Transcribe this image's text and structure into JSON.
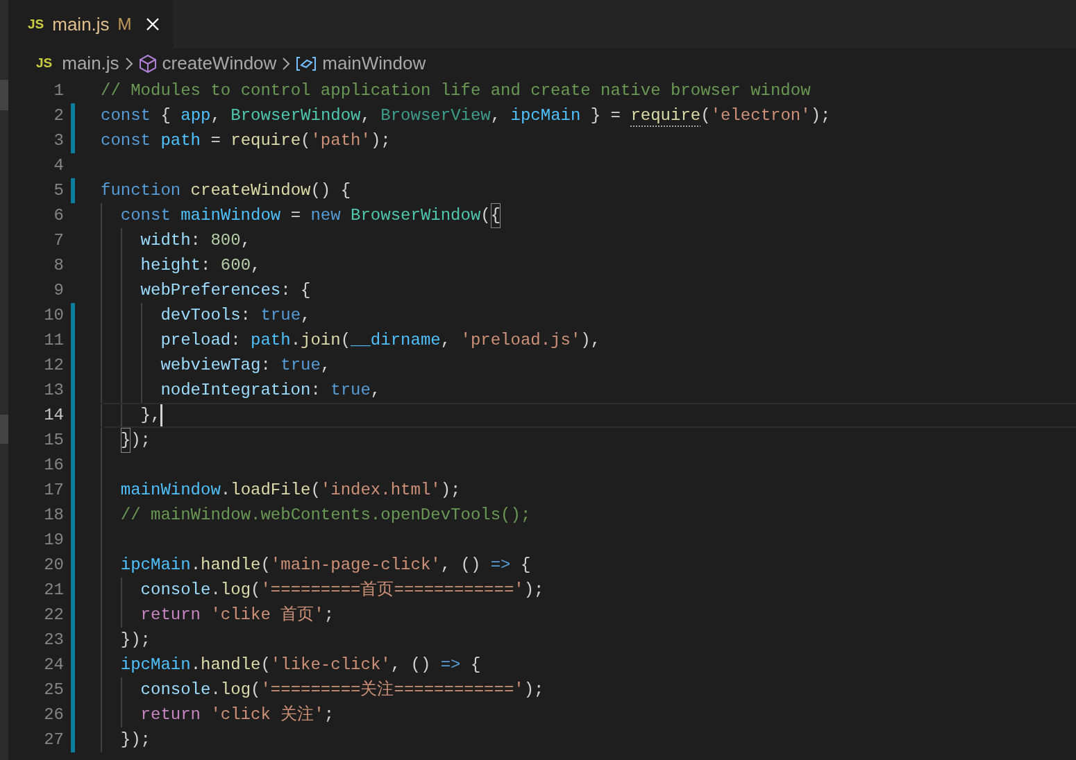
{
  "tab": {
    "file_badge": "JS",
    "title": "main.js",
    "status": "M",
    "selected": true
  },
  "breadcrumbs": [
    {
      "kind": "file",
      "badge": "JS",
      "label": "main.js"
    },
    {
      "kind": "function",
      "label": "createWindow"
    },
    {
      "kind": "variable",
      "label": "mainWindow"
    }
  ],
  "lines": [
    {
      "number": "1",
      "changed": false,
      "current": false,
      "tokens": [
        {
          "kind": "comment",
          "text": "// Modules to control application life and create native browser window"
        }
      ]
    },
    {
      "number": "2",
      "changed": true,
      "current": false,
      "tokens": [
        {
          "kind": "keyword",
          "text": "const"
        },
        {
          "kind": "punct",
          "text": " { "
        },
        {
          "kind": "variable",
          "text": "app"
        },
        {
          "kind": "punct",
          "text": ", "
        },
        {
          "kind": "class",
          "text": "BrowserWindow"
        },
        {
          "kind": "punct",
          "text": ", "
        },
        {
          "kind": "class-unused",
          "text": "BrowserView"
        },
        {
          "kind": "punct",
          "text": ", "
        },
        {
          "kind": "variable",
          "text": "ipcMain"
        },
        {
          "kind": "punct",
          "text": " } = "
        },
        {
          "kind": "function-hint",
          "text": "require"
        },
        {
          "kind": "punct",
          "text": "("
        },
        {
          "kind": "string",
          "text": "'electron'"
        },
        {
          "kind": "punct",
          "text": ");"
        }
      ]
    },
    {
      "number": "3",
      "changed": true,
      "current": false,
      "tokens": [
        {
          "kind": "keyword",
          "text": "const"
        },
        {
          "kind": "variable",
          "text": "path",
          "space_before": true
        },
        {
          "kind": "punct",
          "text": " = "
        },
        {
          "kind": "function",
          "text": "require"
        },
        {
          "kind": "punct",
          "text": "("
        },
        {
          "kind": "string",
          "text": "'path'"
        },
        {
          "kind": "punct",
          "text": ");"
        }
      ]
    },
    {
      "number": "4",
      "changed": false,
      "current": false
    },
    {
      "number": "5",
      "changed": true,
      "current": false,
      "tokens": [
        {
          "kind": "keyword",
          "text": "function"
        },
        {
          "kind": "function",
          "text": "createWindow",
          "space_before": true
        },
        {
          "kind": "punct",
          "text": "() {"
        }
      ],
      "children": [
        {
          "number": "6",
          "changed": false,
          "current": false,
          "tokens": [
            {
              "kind": "keyword",
              "text": "const"
            },
            {
              "kind": "variable",
              "text": "mainWindow",
              "space_before": true
            },
            {
              "kind": "punct",
              "text": " = "
            },
            {
              "kind": "keyword",
              "text": "new"
            },
            {
              "kind": "class",
              "text": "BrowserWindow",
              "space_before": true
            },
            {
              "kind": "punct",
              "text": "("
            },
            {
              "kind": "bracket-match",
              "text": "{"
            }
          ],
          "children": [
            {
              "number": "7",
              "changed": false,
              "current": false,
              "tokens": [
                {
                  "kind": "property",
                  "text": "width"
                },
                {
                  "kind": "punct",
                  "text": ": "
                },
                {
                  "kind": "number",
                  "text": "800"
                },
                {
                  "kind": "punct",
                  "text": ","
                }
              ]
            },
            {
              "number": "8",
              "changed": false,
              "current": false,
              "tokens": [
                {
                  "kind": "property",
                  "text": "height"
                },
                {
                  "kind": "punct",
                  "text": ": "
                },
                {
                  "kind": "number",
                  "text": "600"
                },
                {
                  "kind": "punct",
                  "text": ","
                }
              ]
            },
            {
              "number": "9",
              "changed": false,
              "current": false,
              "tokens": [
                {
                  "kind": "property",
                  "text": "webPreferences"
                },
                {
                  "kind": "punct",
                  "text": ": {"
                }
              ],
              "children": [
                {
                  "number": "10",
                  "changed": true,
                  "current": false,
                  "tokens": [
                    {
                      "kind": "property",
                      "text": "devTools"
                    },
                    {
                      "kind": "punct",
                      "text": ": "
                    },
                    {
                      "kind": "keyword",
                      "text": "true"
                    },
                    {
                      "kind": "punct",
                      "text": ","
                    }
                  ]
                },
                {
                  "number": "11",
                  "changed": true,
                  "current": false,
                  "tokens": [
                    {
                      "kind": "property",
                      "text": "preload"
                    },
                    {
                      "kind": "punct",
                      "text": ": "
                    },
                    {
                      "kind": "variable",
                      "text": "path"
                    },
                    {
                      "kind": "punct",
                      "text": "."
                    },
                    {
                      "kind": "function",
                      "text": "join"
                    },
                    {
                      "kind": "punct",
                      "text": "("
                    },
                    {
                      "kind": "variable",
                      "text": "__dirname"
                    },
                    {
                      "kind": "punct",
                      "text": ", "
                    },
                    {
                      "kind": "string",
                      "text": "'preload.js'"
                    },
                    {
                      "kind": "punct",
                      "text": "),"
                    }
                  ]
                },
                {
                  "number": "12",
                  "changed": true,
                  "current": false,
                  "tokens": [
                    {
                      "kind": "property",
                      "text": "webviewTag"
                    },
                    {
                      "kind": "punct",
                      "text": ": "
                    },
                    {
                      "kind": "keyword",
                      "text": "true"
                    },
                    {
                      "kind": "punct",
                      "text": ","
                    }
                  ]
                },
                {
                  "number": "13",
                  "changed": true,
                  "current": false,
                  "tokens": [
                    {
                      "kind": "property",
                      "text": "nodeIntegration"
                    },
                    {
                      "kind": "punct",
                      "text": ": "
                    },
                    {
                      "kind": "keyword",
                      "text": "true"
                    },
                    {
                      "kind": "punct",
                      "text": ","
                    }
                  ]
                }
              ]
            },
            {
              "number": "14",
              "changed": true,
              "current": true,
              "tokens": [
                {
                  "kind": "punct",
                  "text": "},"
                }
              ]
            }
          ]
        },
        {
          "number": "15",
          "changed": true,
          "current": false,
          "tokens": [
            {
              "kind": "bracket-match",
              "text": "}"
            },
            {
              "kind": "punct",
              "text": ");"
            }
          ]
        },
        {
          "number": "16",
          "changed": true,
          "current": false
        },
        {
          "number": "17",
          "changed": true,
          "current": false,
          "tokens": [
            {
              "kind": "variable",
              "text": "mainWindow"
            },
            {
              "kind": "punct",
              "text": "."
            },
            {
              "kind": "function",
              "text": "loadFile"
            },
            {
              "kind": "punct",
              "text": "("
            },
            {
              "kind": "string",
              "text": "'index.html'"
            },
            {
              "kind": "punct",
              "text": ");"
            }
          ]
        },
        {
          "number": "18",
          "changed": true,
          "current": false,
          "tokens": [
            {
              "kind": "comment",
              "text": "// mainWindow.webContents.openDevTools();"
            }
          ]
        },
        {
          "number": "19",
          "changed": true,
          "current": false
        },
        {
          "number": "20",
          "changed": true,
          "current": false,
          "tokens": [
            {
              "kind": "variable",
              "text": "ipcMain"
            },
            {
              "kind": "punct",
              "text": "."
            },
            {
              "kind": "function",
              "text": "handle"
            },
            {
              "kind": "punct",
              "text": "("
            },
            {
              "kind": "string",
              "text": "'main-page-click'"
            },
            {
              "kind": "punct",
              "text": ", () "
            },
            {
              "kind": "keyword",
              "text": "=>"
            },
            {
              "kind": "punct",
              "text": " {"
            }
          ],
          "children": [
            {
              "number": "21",
              "changed": true,
              "current": false,
              "tokens": [
                {
                  "kind": "property",
                  "text": "console"
                },
                {
                  "kind": "punct",
                  "text": "."
                },
                {
                  "kind": "function",
                  "text": "log"
                },
                {
                  "kind": "punct",
                  "text": "("
                },
                {
                  "kind": "string",
                  "text": "'=========首页============'"
                },
                {
                  "kind": "punct",
                  "text": ");"
                }
              ]
            },
            {
              "number": "22",
              "changed": true,
              "current": false,
              "tokens": [
                {
                  "kind": "control",
                  "text": "return"
                },
                {
                  "kind": "string",
                  "text": "'clike 首页'",
                  "space_before": true
                },
                {
                  "kind": "punct",
                  "text": ";"
                }
              ]
            }
          ]
        },
        {
          "number": "23",
          "changed": true,
          "current": false,
          "tokens": [
            {
              "kind": "punct",
              "text": "});"
            }
          ]
        },
        {
          "number": "24",
          "changed": true,
          "current": false,
          "tokens": [
            {
              "kind": "variable",
              "text": "ipcMain"
            },
            {
              "kind": "punct",
              "text": "."
            },
            {
              "kind": "function",
              "text": "handle"
            },
            {
              "kind": "punct",
              "text": "("
            },
            {
              "kind": "string",
              "text": "'like-click'"
            },
            {
              "kind": "punct",
              "text": ", () "
            },
            {
              "kind": "keyword",
              "text": "=>"
            },
            {
              "kind": "punct",
              "text": " {"
            }
          ],
          "children": [
            {
              "number": "25",
              "changed": true,
              "current": false,
              "tokens": [
                {
                  "kind": "property",
                  "text": "console"
                },
                {
                  "kind": "punct",
                  "text": "."
                },
                {
                  "kind": "function",
                  "text": "log"
                },
                {
                  "kind": "punct",
                  "text": "("
                },
                {
                  "kind": "string",
                  "text": "'=========关注============'"
                },
                {
                  "kind": "punct",
                  "text": ");"
                }
              ]
            },
            {
              "number": "26",
              "changed": true,
              "current": false,
              "tokens": [
                {
                  "kind": "control",
                  "text": "return"
                },
                {
                  "kind": "string",
                  "text": "'click 关注'",
                  "space_before": true
                },
                {
                  "kind": "punct",
                  "text": ";"
                }
              ]
            }
          ]
        },
        {
          "number": "27",
          "changed": true,
          "current": false,
          "tokens": [
            {
              "kind": "punct",
              "text": "});"
            }
          ]
        }
      ]
    }
  ]
}
